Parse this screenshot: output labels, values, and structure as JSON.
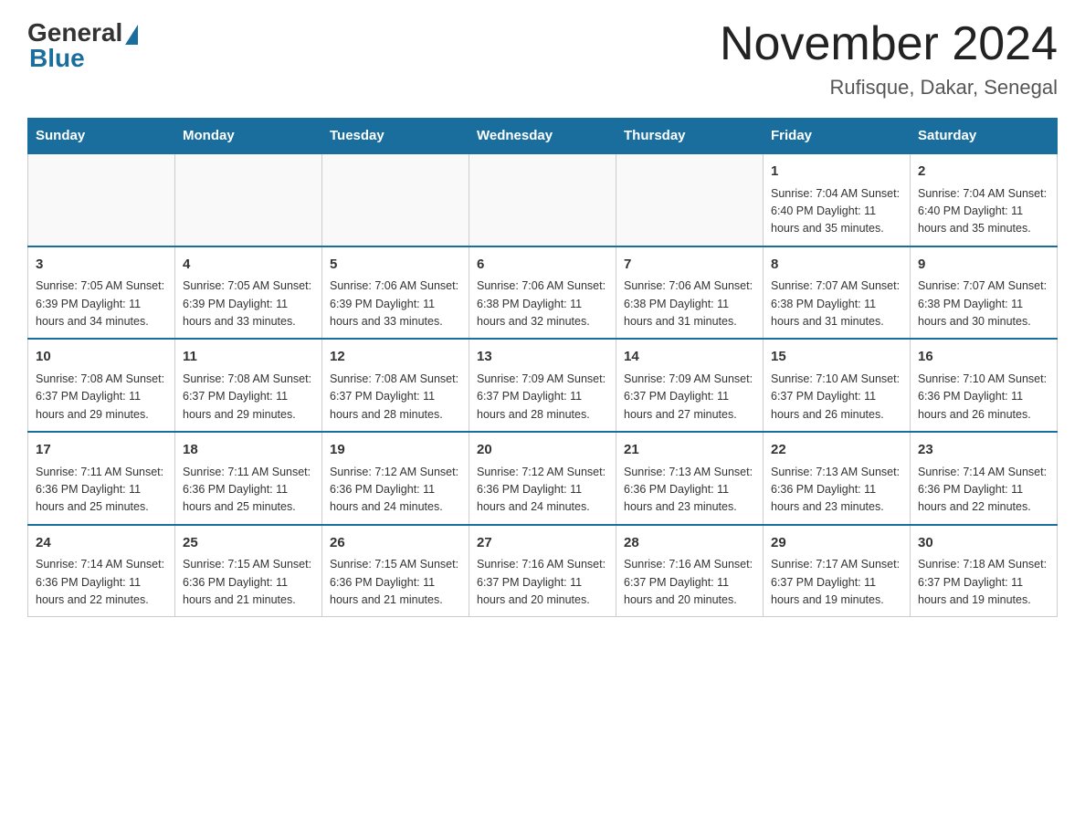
{
  "header": {
    "logo_general": "General",
    "logo_blue": "Blue",
    "title": "November 2024",
    "subtitle": "Rufisque, Dakar, Senegal"
  },
  "days_of_week": [
    "Sunday",
    "Monday",
    "Tuesday",
    "Wednesday",
    "Thursday",
    "Friday",
    "Saturday"
  ],
  "weeks": [
    [
      {
        "day": "",
        "info": ""
      },
      {
        "day": "",
        "info": ""
      },
      {
        "day": "",
        "info": ""
      },
      {
        "day": "",
        "info": ""
      },
      {
        "day": "",
        "info": ""
      },
      {
        "day": "1",
        "info": "Sunrise: 7:04 AM\nSunset: 6:40 PM\nDaylight: 11 hours\nand 35 minutes."
      },
      {
        "day": "2",
        "info": "Sunrise: 7:04 AM\nSunset: 6:40 PM\nDaylight: 11 hours\nand 35 minutes."
      }
    ],
    [
      {
        "day": "3",
        "info": "Sunrise: 7:05 AM\nSunset: 6:39 PM\nDaylight: 11 hours\nand 34 minutes."
      },
      {
        "day": "4",
        "info": "Sunrise: 7:05 AM\nSunset: 6:39 PM\nDaylight: 11 hours\nand 33 minutes."
      },
      {
        "day": "5",
        "info": "Sunrise: 7:06 AM\nSunset: 6:39 PM\nDaylight: 11 hours\nand 33 minutes."
      },
      {
        "day": "6",
        "info": "Sunrise: 7:06 AM\nSunset: 6:38 PM\nDaylight: 11 hours\nand 32 minutes."
      },
      {
        "day": "7",
        "info": "Sunrise: 7:06 AM\nSunset: 6:38 PM\nDaylight: 11 hours\nand 31 minutes."
      },
      {
        "day": "8",
        "info": "Sunrise: 7:07 AM\nSunset: 6:38 PM\nDaylight: 11 hours\nand 31 minutes."
      },
      {
        "day": "9",
        "info": "Sunrise: 7:07 AM\nSunset: 6:38 PM\nDaylight: 11 hours\nand 30 minutes."
      }
    ],
    [
      {
        "day": "10",
        "info": "Sunrise: 7:08 AM\nSunset: 6:37 PM\nDaylight: 11 hours\nand 29 minutes."
      },
      {
        "day": "11",
        "info": "Sunrise: 7:08 AM\nSunset: 6:37 PM\nDaylight: 11 hours\nand 29 minutes."
      },
      {
        "day": "12",
        "info": "Sunrise: 7:08 AM\nSunset: 6:37 PM\nDaylight: 11 hours\nand 28 minutes."
      },
      {
        "day": "13",
        "info": "Sunrise: 7:09 AM\nSunset: 6:37 PM\nDaylight: 11 hours\nand 28 minutes."
      },
      {
        "day": "14",
        "info": "Sunrise: 7:09 AM\nSunset: 6:37 PM\nDaylight: 11 hours\nand 27 minutes."
      },
      {
        "day": "15",
        "info": "Sunrise: 7:10 AM\nSunset: 6:37 PM\nDaylight: 11 hours\nand 26 minutes."
      },
      {
        "day": "16",
        "info": "Sunrise: 7:10 AM\nSunset: 6:36 PM\nDaylight: 11 hours\nand 26 minutes."
      }
    ],
    [
      {
        "day": "17",
        "info": "Sunrise: 7:11 AM\nSunset: 6:36 PM\nDaylight: 11 hours\nand 25 minutes."
      },
      {
        "day": "18",
        "info": "Sunrise: 7:11 AM\nSunset: 6:36 PM\nDaylight: 11 hours\nand 25 minutes."
      },
      {
        "day": "19",
        "info": "Sunrise: 7:12 AM\nSunset: 6:36 PM\nDaylight: 11 hours\nand 24 minutes."
      },
      {
        "day": "20",
        "info": "Sunrise: 7:12 AM\nSunset: 6:36 PM\nDaylight: 11 hours\nand 24 minutes."
      },
      {
        "day": "21",
        "info": "Sunrise: 7:13 AM\nSunset: 6:36 PM\nDaylight: 11 hours\nand 23 minutes."
      },
      {
        "day": "22",
        "info": "Sunrise: 7:13 AM\nSunset: 6:36 PM\nDaylight: 11 hours\nand 23 minutes."
      },
      {
        "day": "23",
        "info": "Sunrise: 7:14 AM\nSunset: 6:36 PM\nDaylight: 11 hours\nand 22 minutes."
      }
    ],
    [
      {
        "day": "24",
        "info": "Sunrise: 7:14 AM\nSunset: 6:36 PM\nDaylight: 11 hours\nand 22 minutes."
      },
      {
        "day": "25",
        "info": "Sunrise: 7:15 AM\nSunset: 6:36 PM\nDaylight: 11 hours\nand 21 minutes."
      },
      {
        "day": "26",
        "info": "Sunrise: 7:15 AM\nSunset: 6:36 PM\nDaylight: 11 hours\nand 21 minutes."
      },
      {
        "day": "27",
        "info": "Sunrise: 7:16 AM\nSunset: 6:37 PM\nDaylight: 11 hours\nand 20 minutes."
      },
      {
        "day": "28",
        "info": "Sunrise: 7:16 AM\nSunset: 6:37 PM\nDaylight: 11 hours\nand 20 minutes."
      },
      {
        "day": "29",
        "info": "Sunrise: 7:17 AM\nSunset: 6:37 PM\nDaylight: 11 hours\nand 19 minutes."
      },
      {
        "day": "30",
        "info": "Sunrise: 7:18 AM\nSunset: 6:37 PM\nDaylight: 11 hours\nand 19 minutes."
      }
    ]
  ]
}
